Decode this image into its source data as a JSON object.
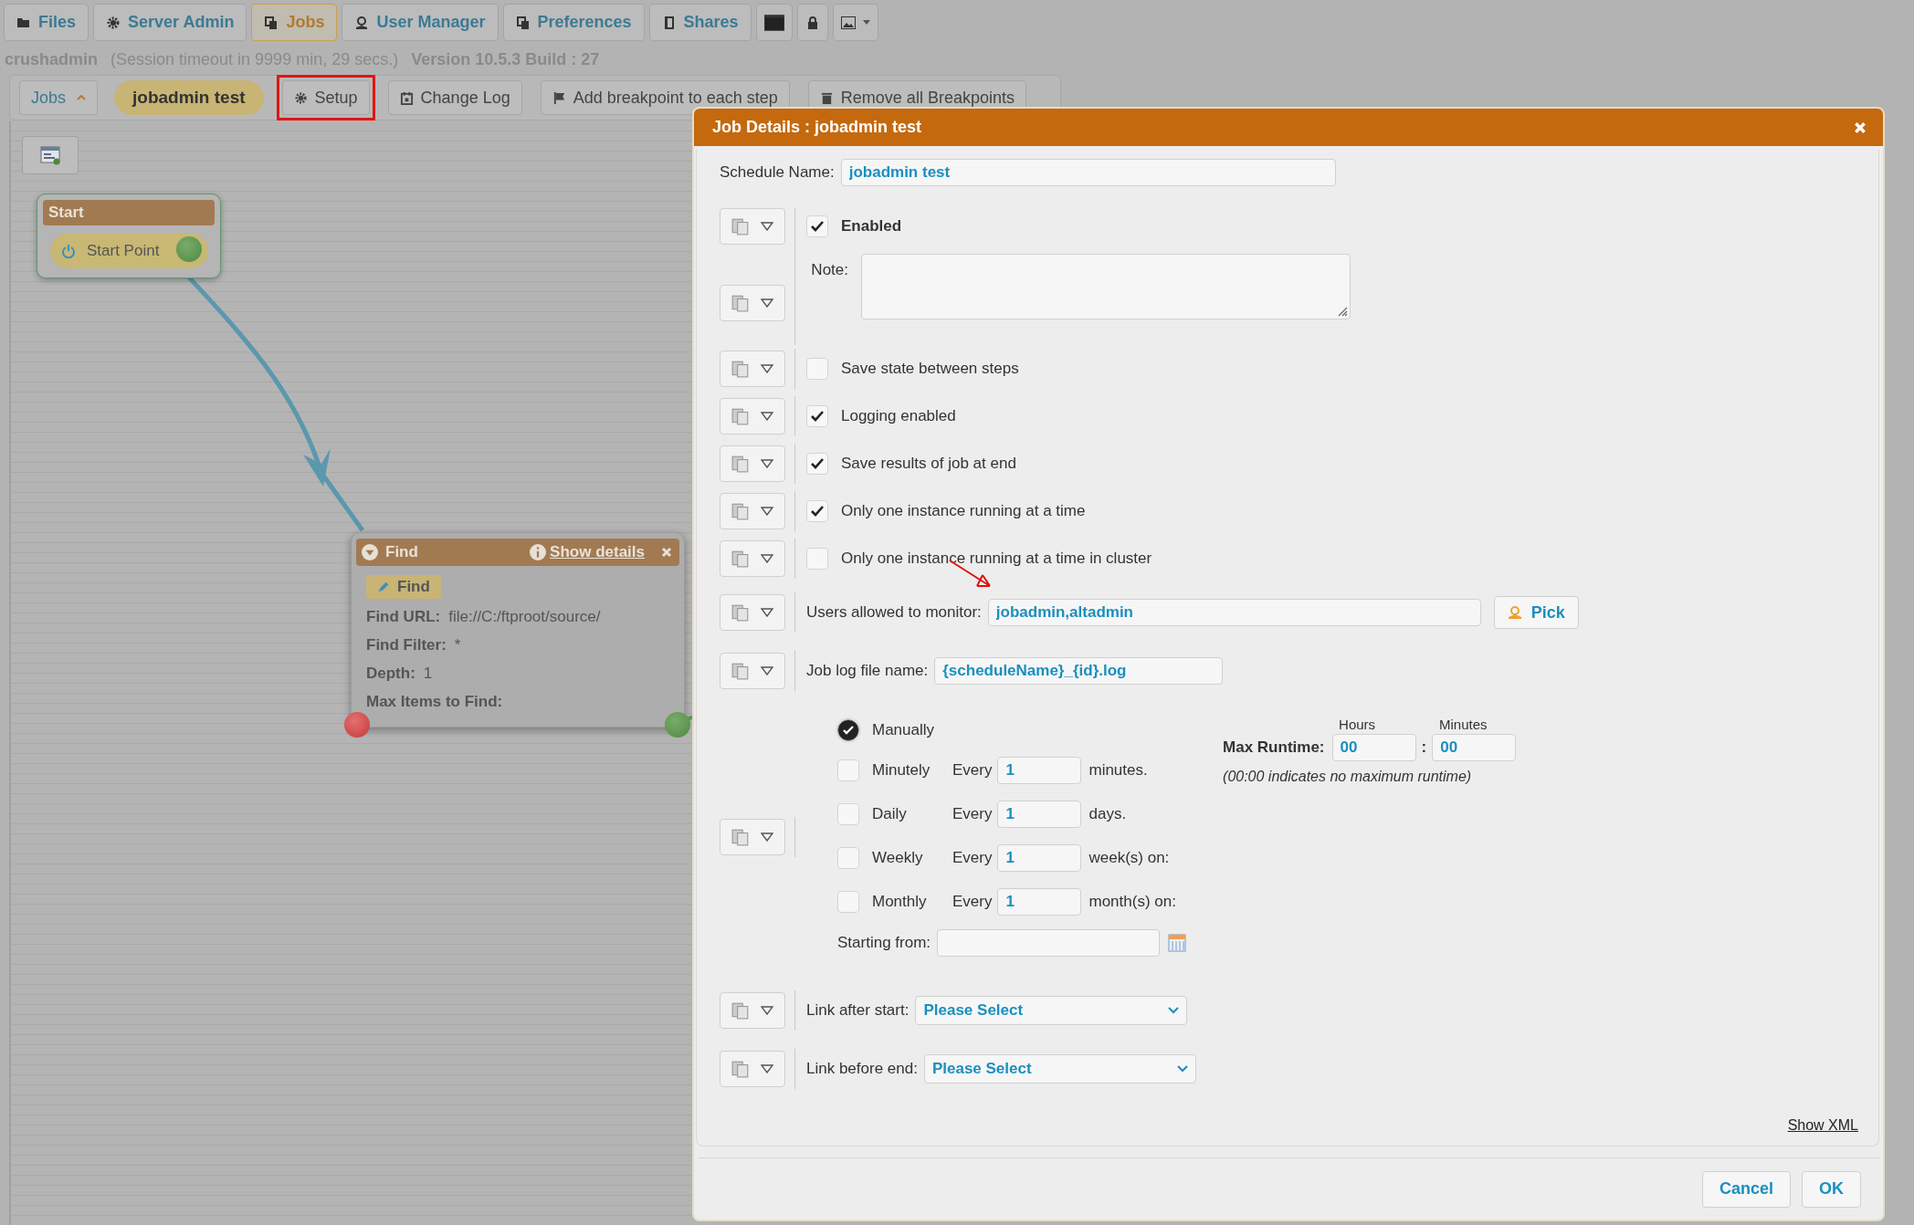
{
  "top_tabs": [
    {
      "label": "Files",
      "kind": "folder",
      "selected": false
    },
    {
      "label": "Server Admin",
      "kind": "gear",
      "selected": false
    },
    {
      "label": "Jobs",
      "kind": "copy",
      "selected": true
    },
    {
      "label": "User Manager",
      "kind": "user",
      "selected": false
    },
    {
      "label": "Preferences",
      "kind": "copy",
      "selected": false
    },
    {
      "label": "Shares",
      "kind": "book",
      "selected": false
    }
  ],
  "session": {
    "user": "crushadmin",
    "timeout": "(Session timeout in 9999 min, 29 secs.)",
    "version": "Version 10.5.3 Build : 27"
  },
  "toolbar": {
    "jobs_menu": "Jobs",
    "job_name": "jobadmin test",
    "buttons": [
      {
        "label": "Setup",
        "kind": "gear",
        "highlighted": true
      },
      {
        "label": "Change Log",
        "kind": "calendar",
        "highlighted": false
      },
      {
        "label": "Add breakpoint to each step",
        "kind": "flag",
        "highlighted": false
      },
      {
        "label": "Remove all Breakpoints",
        "kind": "trash",
        "highlighted": false
      }
    ]
  },
  "canvas": {
    "start_node": {
      "title": "Start",
      "item": "Start Point"
    },
    "find_node": {
      "title": "Find",
      "details_link": "Show details",
      "tag": "Find",
      "fields": [
        {
          "label": "Find URL:",
          "value": "file://C:/ftproot/source/"
        },
        {
          "label": "Find Filter:",
          "value": "*"
        },
        {
          "label": "Depth:",
          "value": "1"
        },
        {
          "label": "Max Items to Find:"
        }
      ]
    }
  },
  "dialog": {
    "title": "Job Details : jobadmin test",
    "schedule_name": {
      "label": "Schedule Name:",
      "value": "jobadmin test"
    },
    "enabled": {
      "label": "Enabled",
      "checked": true
    },
    "note": {
      "label": "Note:"
    },
    "options": [
      {
        "label": "Save state between steps",
        "checked": false
      },
      {
        "label": "Logging enabled",
        "checked": true
      },
      {
        "label": "Save results of job at end",
        "checked": true
      },
      {
        "label": "Only one instance running at a time",
        "checked": true
      },
      {
        "label": "Only one instance running at a time in cluster",
        "checked": false
      }
    ],
    "users_monitor": {
      "label": "Users allowed to monitor:",
      "value": "jobadmin,altadmin",
      "button": "Pick"
    },
    "log_file": {
      "label": "Job log file name:",
      "value": "{scheduleName}_{id}.log"
    },
    "schedule": {
      "modes": [
        {
          "label": "Manually",
          "selected": true
        },
        {
          "label": "Minutely",
          "selected": false,
          "every": "Every",
          "value": "1",
          "unit": "minutes."
        },
        {
          "label": "Daily",
          "selected": false,
          "every": "Every",
          "value": "1",
          "unit": "days."
        },
        {
          "label": "Weekly",
          "selected": false,
          "every": "Every",
          "value": "1",
          "unit": "week(s) on:"
        },
        {
          "label": "Monthly",
          "selected": false,
          "every": "Every",
          "value": "1",
          "unit": "month(s) on:"
        }
      ],
      "starting_from": {
        "label": "Starting from:"
      },
      "max_runtime": {
        "label": "Max Runtime:",
        "hours_label": "Hours",
        "minutes_label": "Minutes",
        "hours": "00",
        "separator": ":",
        "minutes": "00",
        "hint": "(00:00 indicates no maximum runtime)"
      }
    },
    "links": [
      {
        "label": "Link after start:",
        "value": "Please Select"
      },
      {
        "label": "Link before end:",
        "value": "Please Select"
      }
    ],
    "show_xml": "Show XML",
    "buttons": [
      "Cancel",
      "OK"
    ]
  }
}
